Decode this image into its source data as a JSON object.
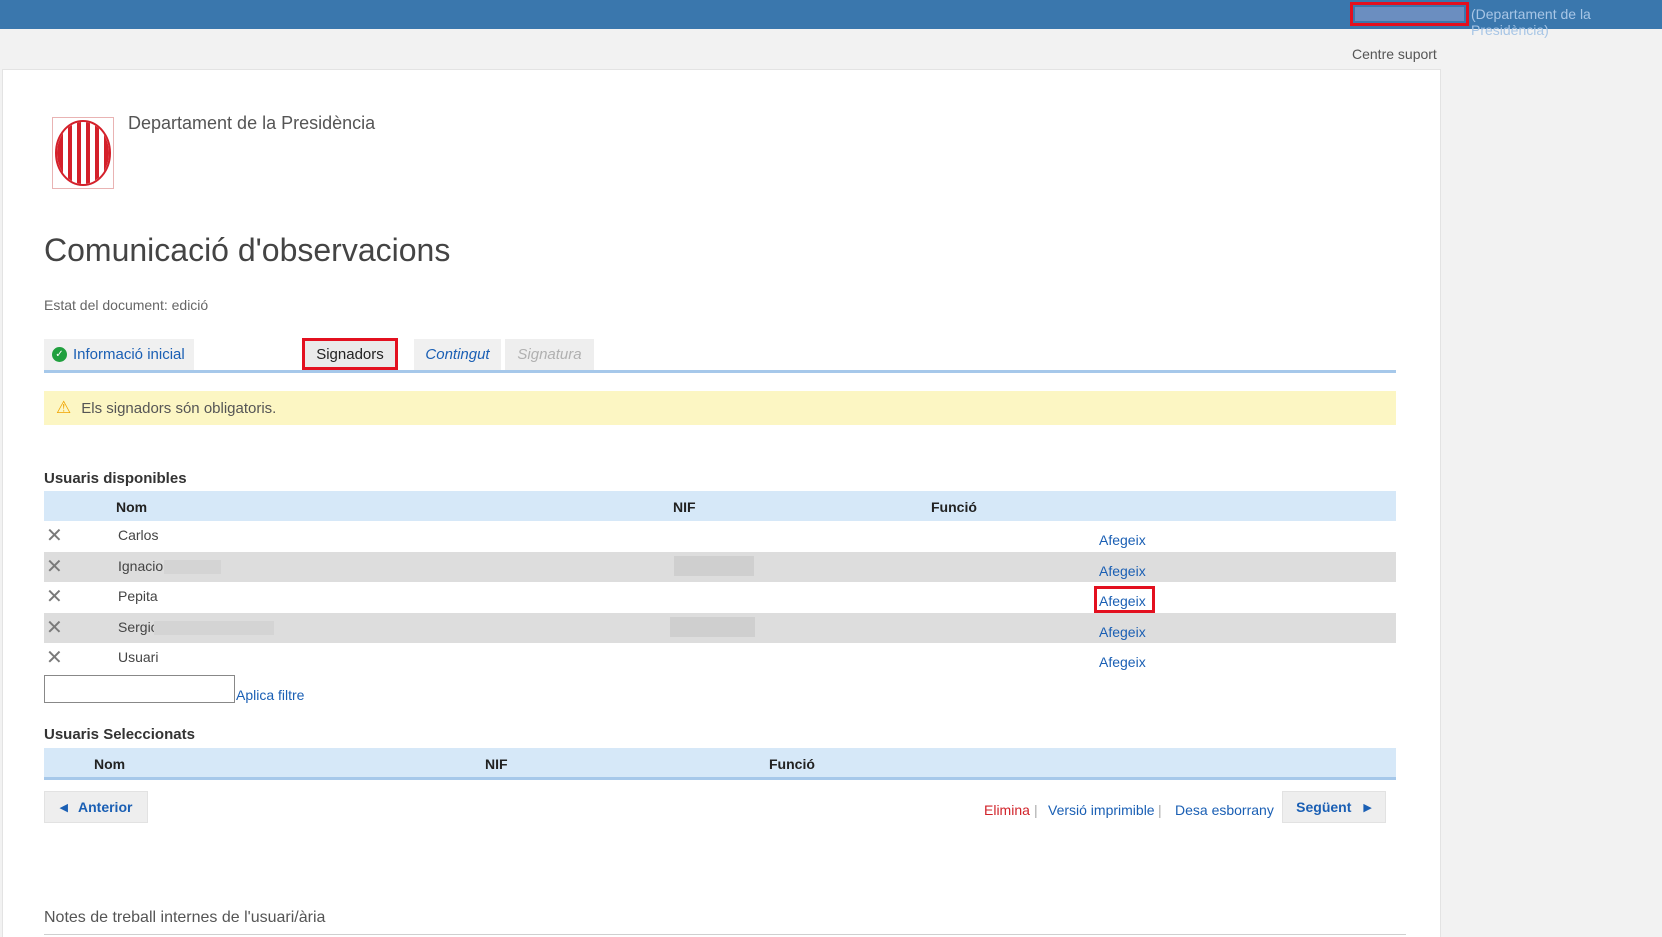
{
  "header": {
    "department_link": "(Departament de la Presidència)",
    "support_link": "Centre suport"
  },
  "org": {
    "name": "Departament de la Presidència"
  },
  "page": {
    "title": "Comunicació d'observacions",
    "state": "Estat del document: edició"
  },
  "tabs": [
    {
      "label": "Informació inicial",
      "status": "complete"
    },
    {
      "label": "Signadors",
      "status": "active"
    },
    {
      "label": "Contingut",
      "status": "pending"
    },
    {
      "label": "Signatura",
      "status": "disabled"
    }
  ],
  "warning": {
    "text": "Els signadors són obligatoris."
  },
  "available_users": {
    "title": "Usuaris disponibles",
    "columns": [
      "Nom",
      "NIF",
      "Funció"
    ],
    "rows": [
      {
        "name": "Carlos",
        "action": "Afegeix"
      },
      {
        "name": "Ignacio",
        "action": "Afegeix"
      },
      {
        "name": "Pepita",
        "action": "Afegeix"
      },
      {
        "name": "Sergio",
        "action": "Afegeix"
      },
      {
        "name": "Usuari",
        "action": "Afegeix"
      }
    ],
    "filter": {
      "value": "",
      "apply_label": "Aplica filtre"
    }
  },
  "selected_users": {
    "title": "Usuaris Seleccionats",
    "columns": [
      "Nom",
      "NIF",
      "Funció"
    ],
    "rows": []
  },
  "footer": {
    "prev_label": "Anterior",
    "next_label": "Següent",
    "delete_label": "Elimina",
    "print_label": "Versió imprimible",
    "draft_label": "Desa esborrany",
    "separator": "|"
  },
  "notes": {
    "title": "Notes de treball internes de l'usuari/ària"
  },
  "colors": {
    "topbar": "#3a77ad",
    "link": "#1a5fb4",
    "highlight": "#e3101f",
    "warning_bg": "#fcf6c3",
    "table_header": "#d6e8f8"
  }
}
